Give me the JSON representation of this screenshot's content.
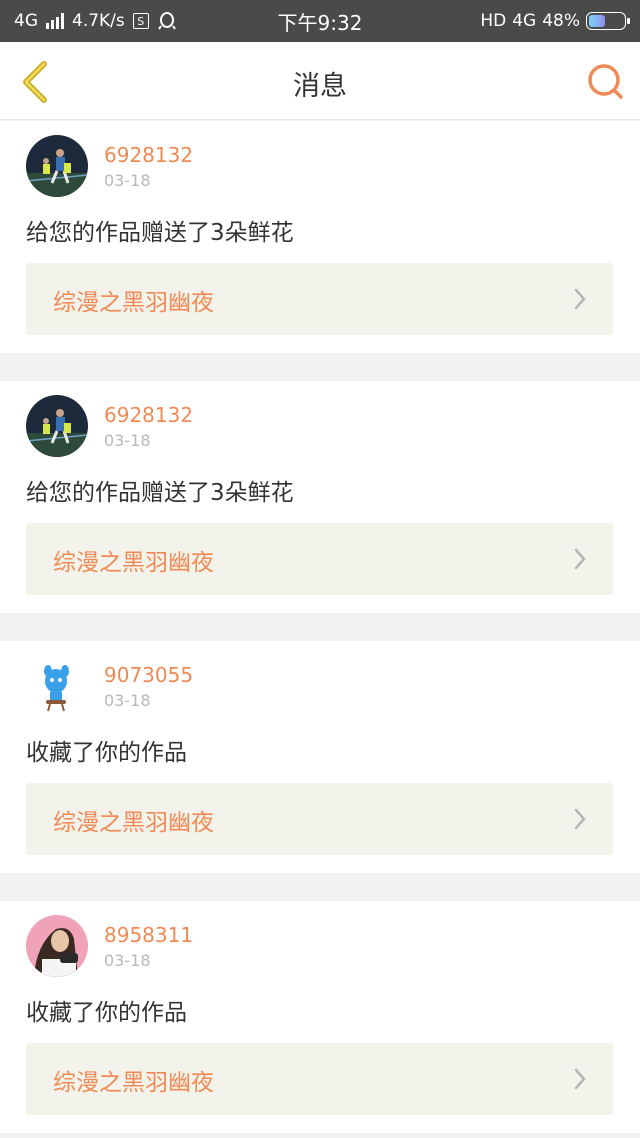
{
  "status_bar": {
    "network": "4G",
    "speed": "4.7K/s",
    "s_icon_text": "S",
    "time": "下午9:32",
    "hd": "HD",
    "net_right": "4G",
    "battery_pct": "48%",
    "battery_level": 0.48
  },
  "nav": {
    "back_icon": "chevron-left-icon",
    "title": "消息",
    "search_icon": "search-icon"
  },
  "accent_color": "#f08a55",
  "messages": [
    {
      "username": "6928132",
      "date": "03-18",
      "action": "给您的作品赠送了3朵鲜花",
      "work_title": "综漫之黑羽幽夜",
      "avatar": "runner-photo"
    },
    {
      "username": "6928132",
      "date": "03-18",
      "action": "给您的作品赠送了3朵鲜花",
      "work_title": "综漫之黑羽幽夜",
      "avatar": "runner-photo"
    },
    {
      "username": "9073055",
      "date": "03-18",
      "action": "收藏了你的作品",
      "work_title": "综漫之黑羽幽夜",
      "avatar": "blue-creature-figure"
    },
    {
      "username": "8958311",
      "date": "03-18",
      "action": "收藏了你的作品",
      "work_title": "综漫之黑羽幽夜",
      "avatar": "woman-photo"
    }
  ]
}
